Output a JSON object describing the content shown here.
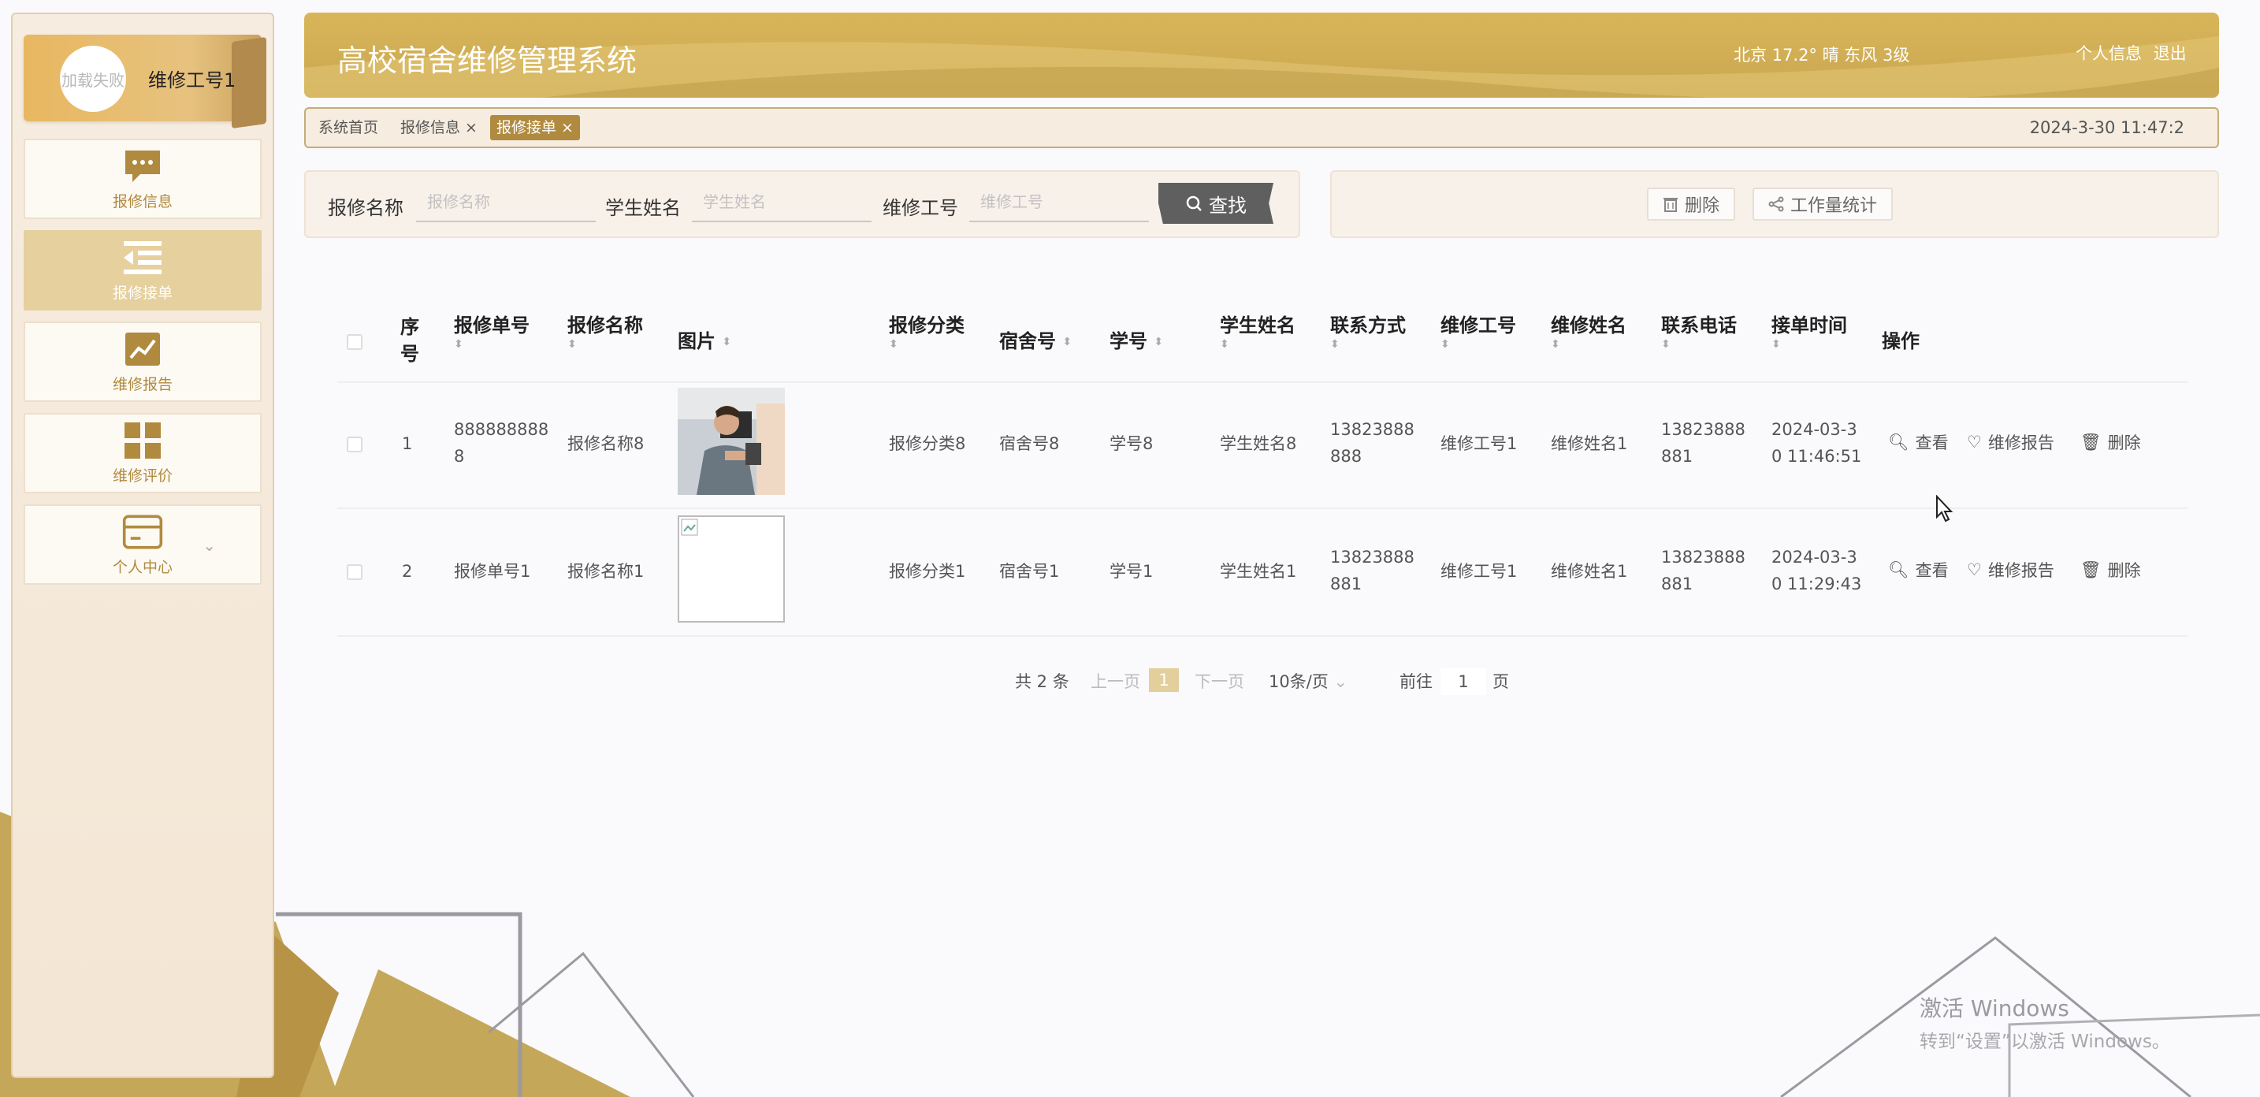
{
  "header": {
    "title": "高校宿舍维修管理系统",
    "weather": "北京  17.2°  晴  东风  3级",
    "links": [
      "个人信息",
      "退出"
    ]
  },
  "sidebar": {
    "avatar_text": "加载失败",
    "user_name": "维修工号1",
    "items": [
      {
        "label": "报修信息",
        "icon": "chat-bubble-icon"
      },
      {
        "label": "报修接单",
        "icon": "list-indent-icon",
        "active": true
      },
      {
        "label": "维修报告",
        "icon": "trend-chart-icon"
      },
      {
        "label": "维修评价",
        "icon": "grid-icon"
      },
      {
        "label": "个人中心",
        "icon": "card-icon",
        "has_children": true
      }
    ]
  },
  "tabs": [
    {
      "label": "系统首页"
    },
    {
      "label": "报修信息 ×"
    },
    {
      "label": "报修接单 ×",
      "active": true
    }
  ],
  "datetime": "2024-3-30 11:47:2",
  "search": {
    "fields": [
      {
        "label": "报修名称",
        "placeholder": "报修名称"
      },
      {
        "label": "学生姓名",
        "placeholder": "学生姓名"
      },
      {
        "label": "维修工号",
        "placeholder": "维修工号"
      }
    ],
    "button": "查找"
  },
  "actions": {
    "delete": "删除",
    "stats": "工作量统计"
  },
  "table": {
    "headers": {
      "index": "序号",
      "order_no": "报修单号",
      "name": "报修名称",
      "image": "图片",
      "category": "报修分类",
      "dorm": "宿舍号",
      "student_no": "学号",
      "student_name": "学生姓名",
      "contact": "联系方式",
      "worker_no": "维修工号",
      "worker_name": "维修姓名",
      "phone": "联系电话",
      "time": "接单时间",
      "ops": "操作"
    },
    "rows": [
      {
        "index": "1",
        "order_no_1": "888888888",
        "order_no_2": "8",
        "name": "报修名称8",
        "image": "photo",
        "category": "报修分类8",
        "dorm": "宿舍号8",
        "student_no": "学号8",
        "student_name": "学生姓名8",
        "contact_1": "13823888",
        "contact_2": "888",
        "worker_no": "维修工号1",
        "worker_name": "维修姓名1",
        "phone_1": "13823888",
        "phone_2": "881",
        "time_1": "2024-03-3",
        "time_2": "0 11:46:51"
      },
      {
        "index": "2",
        "order_no_1": "报修单号1",
        "order_no_2": "",
        "name": "报修名称1",
        "image": "broken",
        "category": "报修分类1",
        "dorm": "宿舍号1",
        "student_no": "学号1",
        "student_name": "学生姓名1",
        "contact_1": "13823888",
        "contact_2": "881",
        "worker_no": "维修工号1",
        "worker_name": "维修姓名1",
        "phone_1": "13823888",
        "phone_2": "881",
        "time_1": "2024-03-3",
        "time_2": "0 11:29:43"
      }
    ],
    "row_ops": [
      "查看",
      "维修报告",
      "删除"
    ]
  },
  "pagination": {
    "total": "共 2 条",
    "prev": "上一页",
    "current": "1",
    "next": "下一页",
    "page_size": "10条/页",
    "goto_prefix": "前往",
    "goto_value": "1",
    "goto_suffix": "页"
  },
  "watermark": {
    "line1": "激活 Windows",
    "line2": "转到“设置”以激活 Windows。"
  },
  "colors": {
    "accent": "#c9a74f",
    "active_tab": "#b08a3f",
    "menu_active": "#e5d09e",
    "search_button": "#5f5f5f"
  }
}
